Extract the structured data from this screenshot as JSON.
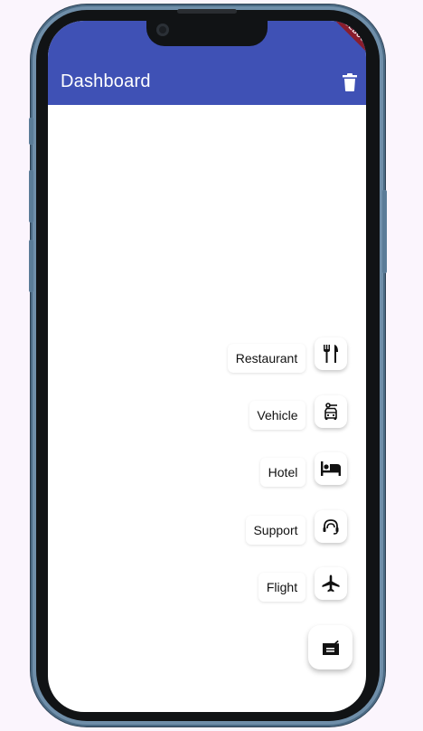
{
  "app_bar": {
    "title": "Dashboard",
    "action_icon": "delete-icon",
    "color": "#3f51b5"
  },
  "debug_banner": {
    "label": "DEBUG",
    "color": "#8a1d2d"
  },
  "speed_dial": {
    "items": [
      {
        "label": "Restaurant",
        "icon": "restaurant-icon"
      },
      {
        "label": "Vehicle",
        "icon": "vehicle-icon"
      },
      {
        "label": "Hotel",
        "icon": "hotel-icon"
      },
      {
        "label": "Support",
        "icon": "support-icon"
      },
      {
        "label": "Flight",
        "icon": "flight-icon"
      }
    ],
    "main_icon": "dashboard-card-icon"
  }
}
